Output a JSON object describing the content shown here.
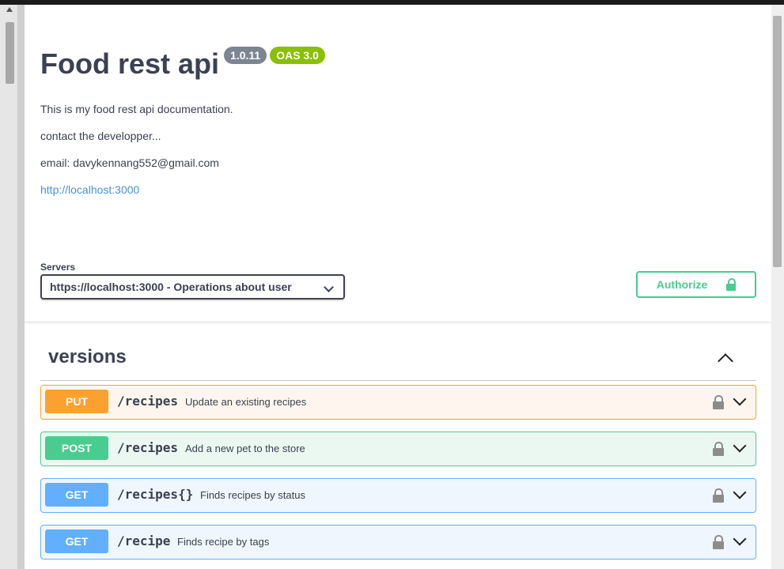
{
  "info": {
    "title": "Food rest api",
    "version_badge": "1.0.11",
    "oas_badge": "OAS 3.0",
    "description": "This is my food rest api documentation.",
    "contact": "contact the developper...",
    "email": "email: davykennang552@gmail.com",
    "link": "http://localhost:3000"
  },
  "servers": {
    "label": "Servers",
    "selected": "https://localhost:3000 - Operations about user"
  },
  "authorize": {
    "label": "Authorize",
    "icon": "lock-icon",
    "color": "#49cc90"
  },
  "tag": {
    "name": "versions"
  },
  "operations": [
    {
      "method": "PUT",
      "path": "/recipes",
      "summary": "Update an existing recipes",
      "color": "#fca130"
    },
    {
      "method": "POST",
      "path": "/recipes",
      "summary": "Add a new pet to the store",
      "color": "#49cc90"
    },
    {
      "method": "GET",
      "path": "/recipes{}",
      "summary": "Finds recipes by status",
      "color": "#61affe"
    },
    {
      "method": "GET",
      "path": "/recipe",
      "summary": "Finds recipe by tags",
      "color": "#61affe"
    }
  ]
}
